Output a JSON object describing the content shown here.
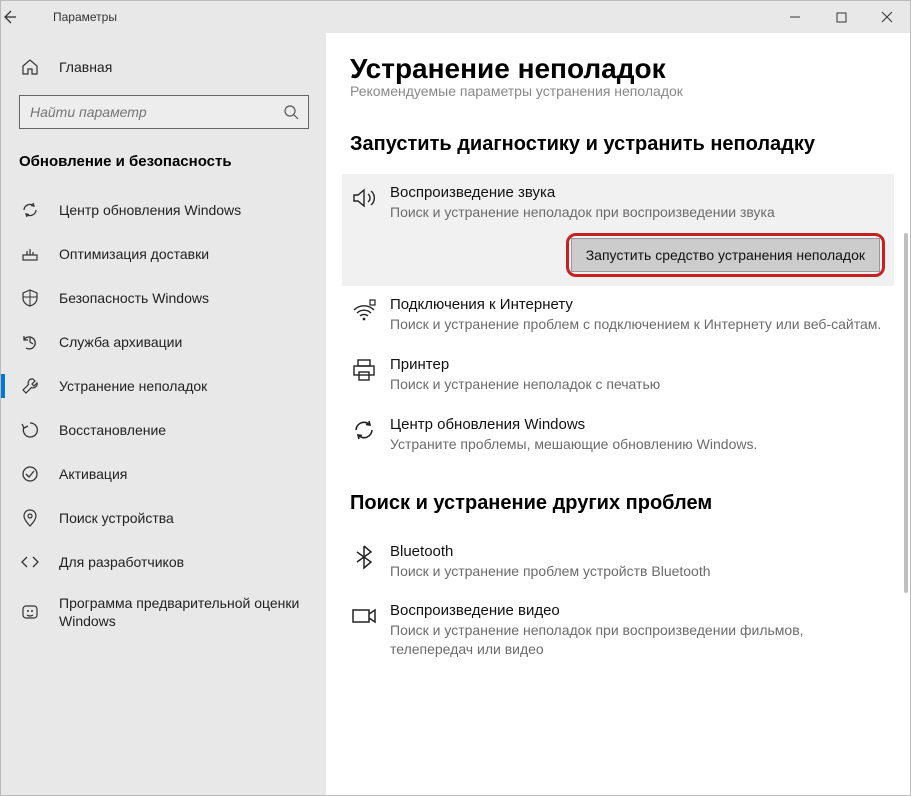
{
  "titlebar": {
    "title": "Параметры"
  },
  "sidebar": {
    "home": "Главная",
    "search_placeholder": "Найти параметр",
    "category": "Обновление и безопасность",
    "items": [
      {
        "label": "Центр обновления Windows"
      },
      {
        "label": "Оптимизация доставки"
      },
      {
        "label": "Безопасность Windows"
      },
      {
        "label": "Служба архивации"
      },
      {
        "label": "Устранение неполадок"
      },
      {
        "label": "Восстановление"
      },
      {
        "label": "Активация"
      },
      {
        "label": "Поиск устройства"
      },
      {
        "label": "Для разработчиков"
      },
      {
        "label": "Программа предварительной оценки Windows"
      }
    ]
  },
  "content": {
    "heading": "Устранение неполадок",
    "cut_text": "Рекомендуемые параметры устранения неполадок",
    "section_a": "Запустить диагностику и устранить неполадку",
    "section_b": "Поиск и устранение других проблем",
    "run_button": "Запустить средство устранения неполадок",
    "items_a": [
      {
        "title": "Воспроизведение звука",
        "desc": "Поиск и устранение неполадок при воспроизведении звука"
      },
      {
        "title": "Подключения к Интернету",
        "desc": "Поиск и устранение проблем с подключением к Интернету или веб-сайтам."
      },
      {
        "title": "Принтер",
        "desc": "Поиск и устранение неполадок с печатью"
      },
      {
        "title": "Центр обновления Windows",
        "desc": "Устраните проблемы, мешающие обновлению Windows."
      }
    ],
    "items_b": [
      {
        "title": "Bluetooth",
        "desc": "Поиск и устранение проблем устройств Bluetooth"
      },
      {
        "title": "Воспроизведение видео",
        "desc": "Поиск и устранение неполадок при воспроизведении фильмов, телепередач или видео"
      }
    ]
  }
}
